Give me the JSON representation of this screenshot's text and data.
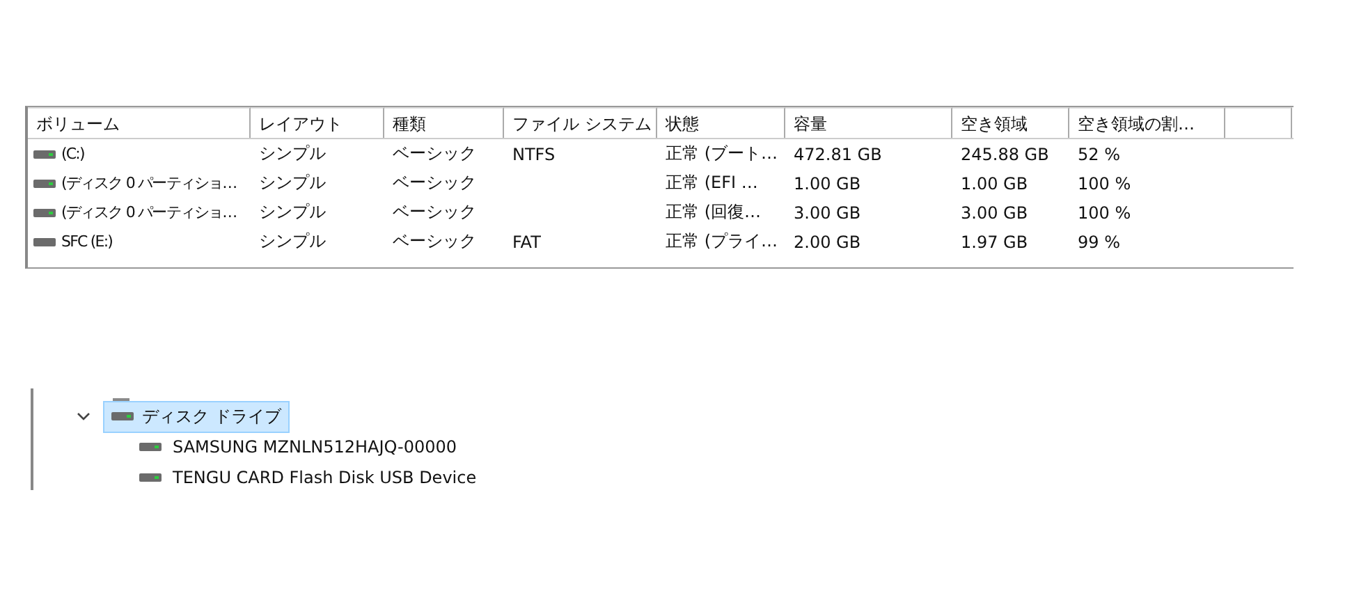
{
  "volume_table": {
    "columns": [
      "ボリューム",
      "レイアウト",
      "種類",
      "ファイル システム",
      "状態",
      "容量",
      "空き領域",
      "空き領域の割…"
    ],
    "rows": [
      {
        "kind": "system",
        "cells": [
          "(C:)",
          "シンプル",
          "ベーシック",
          "NTFS",
          "正常 (ブート…",
          "472.81 GB",
          "245.88 GB",
          "52 %"
        ]
      },
      {
        "kind": "system",
        "cells": [
          "(ディスク 0 パーティショ…",
          "シンプル",
          "ベーシック",
          "",
          "正常 (EFI …",
          "1.00 GB",
          "1.00 GB",
          "100 %"
        ]
      },
      {
        "kind": "system",
        "cells": [
          "(ディスク 0 パーティショ…",
          "シンプル",
          "ベーシック",
          "",
          "正常 (回復…",
          "3.00 GB",
          "3.00 GB",
          "100 %"
        ]
      },
      {
        "kind": "plain",
        "cells": [
          "SFC (E:)",
          "シンプル",
          "ベーシック",
          "FAT",
          "正常 (プライ…",
          "2.00 GB",
          "1.97 GB",
          "99 %"
        ]
      }
    ]
  },
  "device_tree": {
    "category": {
      "label": "ディスク ドライブ",
      "expanded": true,
      "selected": true,
      "children": [
        {
          "label": "SAMSUNG MZNLN512HAJQ-00000"
        },
        {
          "label": "TENGU CARD Flash Disk USB Device"
        }
      ]
    }
  }
}
